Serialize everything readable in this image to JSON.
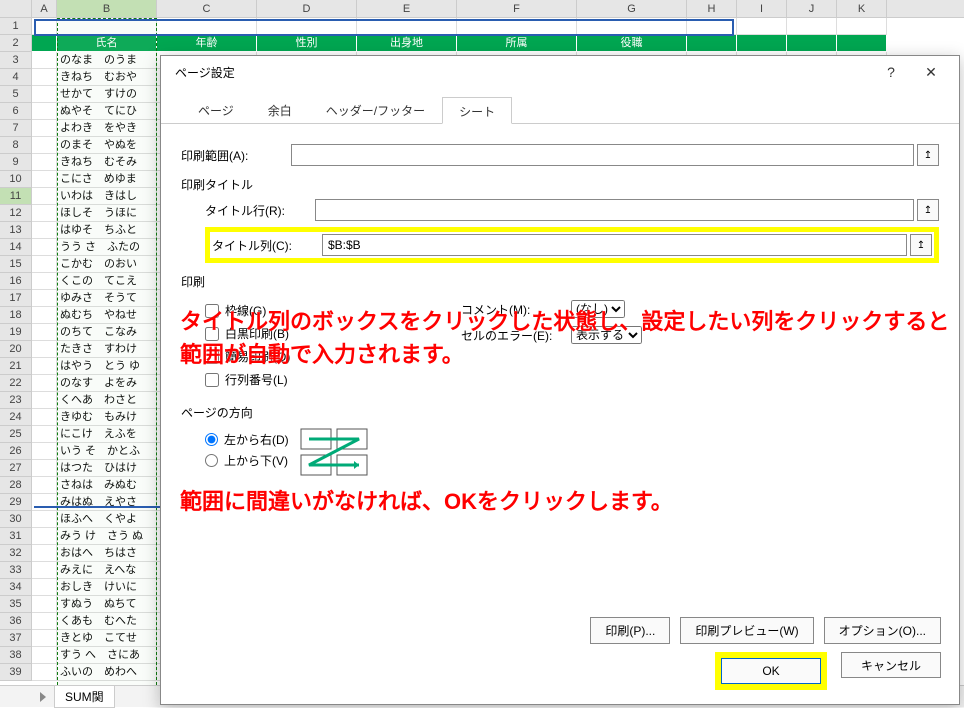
{
  "columns": [
    "A",
    "B",
    "C",
    "D",
    "E",
    "F",
    "G",
    "H",
    "I",
    "J",
    "K"
  ],
  "headersRow1": [
    "",
    "氏名",
    "年齢",
    "性別",
    "出身地",
    "所属",
    "役職",
    "",
    "",
    "",
    ""
  ],
  "data_rows": [
    [
      "のなま　のうま"
    ],
    [
      "きねち　むおや"
    ],
    [
      "せかて　すけの"
    ],
    [
      "ぬやそ　てにひ"
    ],
    [
      "よわき　をやき"
    ],
    [
      "のまそ　やぬを"
    ],
    [
      "きねち　むそみ"
    ],
    [
      "こにさ　めゆま"
    ],
    [
      "いわは　きはし"
    ],
    [
      "ほしそ　うほに"
    ],
    [
      "はゆそ　ちふと"
    ],
    [
      "うう さ　ふたの"
    ],
    [
      "こかむ　のおい"
    ],
    [
      "くこの　てこえ"
    ],
    [
      "ゆみさ　そうて"
    ],
    [
      "ぬむち　やねせ"
    ],
    [
      "のちて　こなみ"
    ],
    [
      "たきさ　すわけ"
    ],
    [
      "はやう　とう ゆ"
    ],
    [
      "のなす　よをみ"
    ],
    [
      "くへあ　わさと"
    ],
    [
      "きゆむ　もみけ"
    ],
    [
      "にこけ　えふを"
    ],
    [
      "いう そ　かとふ"
    ],
    [
      "はつた　ひはけ"
    ],
    [
      "さねは　みぬむ"
    ],
    [
      "みはぬ　えやさ"
    ],
    [
      "ほふへ　くやよ"
    ],
    [
      "みう け　さう ぬ"
    ],
    [
      "おはへ　ちはさ"
    ],
    [
      "みえに　えへな"
    ],
    [
      "おしき　けいに"
    ],
    [
      "すぬう　ぬちて"
    ],
    [
      "くあも　むへた"
    ],
    [
      "きとゆ　こてせ"
    ],
    [
      "すう へ　さにあ"
    ],
    [
      "ふいの　めわへ"
    ]
  ],
  "sheet_tab": "SUM関",
  "dialog": {
    "title": "ページ設定",
    "help": "?",
    "close": "✕",
    "tabs": [
      "ページ",
      "余白",
      "ヘッダー/フッター",
      "シート"
    ],
    "active_tab": 3,
    "print_area_label": "印刷範囲(A):",
    "print_area_value": "",
    "print_titles": "印刷タイトル",
    "title_row_label": "タイトル行(R):",
    "title_row_value": "",
    "title_col_label": "タイトル列(C):",
    "title_col_value": "$B:$B",
    "print_section": "印刷",
    "cb_gridlines": "枠線(G)",
    "cb_bw": "白黒印刷(B)",
    "cb_draft": "簡易印刷(Q)",
    "cb_rowcol": "行列番号(L)",
    "comments_label": "コメント(M):",
    "comments_value": "(なし)",
    "cellerr_label": "セルのエラー(E):",
    "cellerr_value": "表示する",
    "page_order": "ページの方向",
    "radio_ltr": "左から右(D)",
    "radio_ttb": "上から下(V)",
    "btn_print": "印刷(P)...",
    "btn_preview": "印刷プレビュー(W)",
    "btn_options": "オプション(O)...",
    "btn_ok": "OK",
    "btn_cancel": "キャンセル"
  },
  "annotation1": "タイトル列のボックスをクリックした状態し、設定したい列をクリックすると範囲が自動で入力されます。",
  "annotation2": "範囲に間違いがなければ、OKをクリックします。"
}
